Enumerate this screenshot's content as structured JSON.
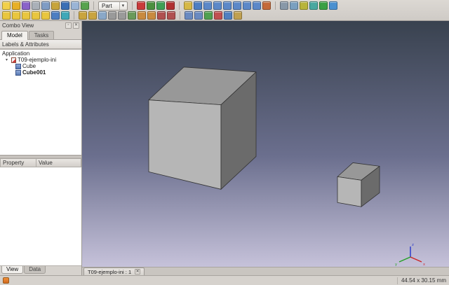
{
  "toolbars": {
    "workbench_selector": {
      "value": "Part",
      "arrow": "▾"
    },
    "file_icons": [
      {
        "name": "new-document-icon",
        "color": "#f2d04b"
      },
      {
        "name": "open-document-icon",
        "color": "#e8b027"
      },
      {
        "name": "save-icon",
        "color": "#8a63c9"
      },
      {
        "name": "cut-icon",
        "color": "#aab0b8"
      },
      {
        "name": "copy-icon",
        "color": "#7f9cc4"
      },
      {
        "name": "paste-icon",
        "color": "#c7a43b"
      },
      {
        "name": "undo-icon",
        "color": "#3a6fb5"
      },
      {
        "name": "redo-icon",
        "color": "#9ab4d6"
      },
      {
        "name": "refresh-icon",
        "color": "#57a34e"
      }
    ],
    "macro_icons": [
      {
        "name": "macro-record-icon",
        "color": "#c93a3a"
      },
      {
        "name": "macro-open-icon",
        "color": "#4b8f3f"
      },
      {
        "name": "macro-execute-icon",
        "color": "#3f9f55"
      },
      {
        "name": "macro-stop-icon",
        "color": "#b03030"
      }
    ],
    "view_icons": [
      {
        "name": "fit-all-icon",
        "color": "#d6b845"
      },
      {
        "name": "axonometric-view-icon",
        "color": "#4d7ec2"
      },
      {
        "name": "front-view-icon",
        "color": "#5c88c8"
      },
      {
        "name": "top-view-icon",
        "color": "#5c88c8"
      },
      {
        "name": "right-view-icon",
        "color": "#5c88c8"
      },
      {
        "name": "rear-view-icon",
        "color": "#5c88c8"
      },
      {
        "name": "bottom-view-icon",
        "color": "#5c88c8"
      },
      {
        "name": "left-view-icon",
        "color": "#5c88c8"
      },
      {
        "name": "measure-distance-icon",
        "color": "#c46a3a"
      }
    ],
    "misc_icons": [
      {
        "name": "draw-style-icon",
        "color": "#8898a8"
      },
      {
        "name": "clipping-plane-icon",
        "color": "#7aa0c0"
      },
      {
        "name": "texture-icon",
        "color": "#b8b43a"
      },
      {
        "name": "scene-inspector-icon",
        "color": "#4aa8a0"
      },
      {
        "name": "dependency-graph-icon",
        "color": "#3aa045"
      },
      {
        "name": "check-geometry-icon",
        "color": "#4a90d0"
      }
    ],
    "part_primitive_icons": [
      {
        "name": "part-box-icon",
        "color": "#e9c63f"
      },
      {
        "name": "part-cylinder-icon",
        "color": "#e9c63f"
      },
      {
        "name": "part-sphere-icon",
        "color": "#e9c63f"
      },
      {
        "name": "part-cone-icon",
        "color": "#e9c63f"
      },
      {
        "name": "part-torus-icon",
        "color": "#e9c63f"
      },
      {
        "name": "part-primitives-icon",
        "color": "#4d7ec2"
      },
      {
        "name": "part-shapebuilder-icon",
        "color": "#3fa8b8"
      }
    ],
    "part_tool_icons": [
      {
        "name": "part-extrude-icon",
        "color": "#c9a43f"
      },
      {
        "name": "part-revolve-icon",
        "color": "#c9a43f"
      },
      {
        "name": "part-mirror-icon",
        "color": "#8aa8c8"
      },
      {
        "name": "part-fillet-icon",
        "color": "#9a9a9a"
      },
      {
        "name": "part-chamfer-icon",
        "color": "#9a9a9a"
      },
      {
        "name": "part-ruled-surface-icon",
        "color": "#6a9a5a"
      },
      {
        "name": "part-loft-icon",
        "color": "#c98a3f"
      },
      {
        "name": "part-sweep-icon",
        "color": "#c98a3f"
      },
      {
        "name": "part-section-icon",
        "color": "#b05050"
      },
      {
        "name": "part-cross-sections-icon",
        "color": "#b05050"
      }
    ],
    "boolean_icons": [
      {
        "name": "part-offset-icon",
        "color": "#6a8ac0"
      },
      {
        "name": "part-thickness-icon",
        "color": "#6a8ac0"
      },
      {
        "name": "part-boolean-icon",
        "color": "#50a050"
      },
      {
        "name": "part-cut-icon",
        "color": "#c05050"
      },
      {
        "name": "part-union-icon",
        "color": "#5080c0"
      },
      {
        "name": "part-intersection-icon",
        "color": "#c0a050"
      }
    ]
  },
  "combo_view": {
    "title": "Combo View",
    "glyphs": {
      "float": "▫",
      "close": "✕",
      "expander": "▾"
    },
    "tabs": [
      {
        "label": "Model"
      },
      {
        "label": "Tasks"
      }
    ],
    "tree_header": "Labels & Attributes",
    "application_label": "Application",
    "document_label": "T09-ejemplo-ini",
    "children": [
      {
        "label": "Cube"
      },
      {
        "label": "Cube001"
      }
    ],
    "property_columns": [
      "Property",
      "Value"
    ],
    "bottom_tabs": [
      {
        "label": "View"
      },
      {
        "label": "Data"
      }
    ]
  },
  "viewport": {
    "gradient_top": "#39424f",
    "gradient_mid": "#6b6f8e",
    "gradient_bottom": "#c6c2da",
    "colors": {
      "cube_top": "#989898",
      "cube_front": "#b6b6b6",
      "cube_side": "#6b6b6b"
    },
    "axis": {
      "x_color": "#cc2222",
      "y_color": "#22a022",
      "z_color": "#2233cc",
      "x_label": "x",
      "y_label": "y",
      "z_label": "z"
    }
  },
  "document_tab": {
    "label": "T09-ejemplo-ini : 1",
    "close": "✕"
  },
  "status_bar": {
    "dimensions": "44.54 x 30.15 mm"
  }
}
